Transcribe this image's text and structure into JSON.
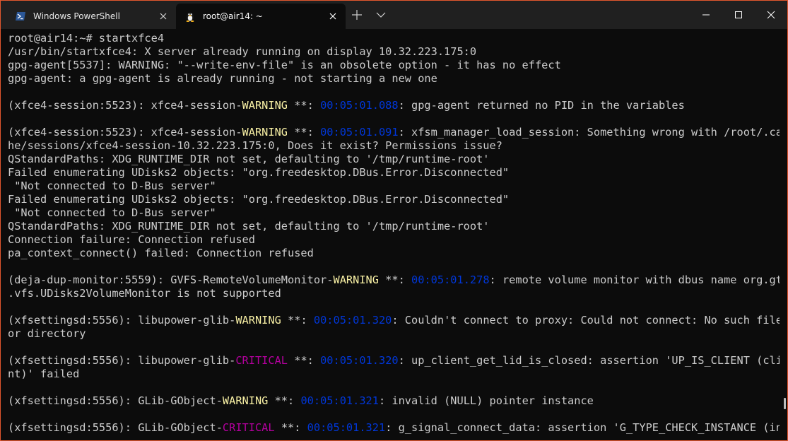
{
  "window": {
    "accent_color": "#e3572e",
    "background_color": "#0c0c0c"
  },
  "tabs": [
    {
      "title": "Windows PowerShell",
      "icon": "powershell-icon",
      "active": false
    },
    {
      "title": "root@air14: ~",
      "icon": "linux-tux-icon",
      "active": true
    }
  ],
  "colors": {
    "normal": "#cccccc",
    "warning": "#f9f1a5",
    "critical": "#b4009e",
    "timestamp": "#0037da"
  },
  "terminal": {
    "lines": [
      [
        {
          "t": "root@air14:~# startxfce4",
          "c": "normal"
        }
      ],
      [
        {
          "t": "/usr/bin/startxfce4: X server already running on display 10.32.223.175:0",
          "c": "normal"
        }
      ],
      [
        {
          "t": "gpg-agent[5537]: WARNING: \"--write-env-file\" is an obsolete option - it has no effect",
          "c": "normal"
        }
      ],
      [
        {
          "t": "gpg-agent: a gpg-agent is already running - not starting a new one",
          "c": "normal"
        }
      ],
      [],
      [
        {
          "t": "(xfce4-session:5523): xfce4-session-",
          "c": "normal"
        },
        {
          "t": "WARNING",
          "c": "warning"
        },
        {
          "t": " **: ",
          "c": "normal"
        },
        {
          "t": "00:05:01.088",
          "c": "timestamp"
        },
        {
          "t": ": gpg-agent returned no PID in the variables",
          "c": "normal"
        }
      ],
      [],
      [
        {
          "t": "(xfce4-session:5523): xfce4-session-",
          "c": "normal"
        },
        {
          "t": "WARNING",
          "c": "warning"
        },
        {
          "t": " **: ",
          "c": "normal"
        },
        {
          "t": "00:05:01.091",
          "c": "timestamp"
        },
        {
          "t": ": xfsm_manager_load_session: Something wrong with /root/.cac",
          "c": "normal"
        }
      ],
      [
        {
          "t": "he/sessions/xfce4-session-10.32.223.175:0, Does it exist? Permissions issue?",
          "c": "normal"
        }
      ],
      [
        {
          "t": "QStandardPaths: XDG_RUNTIME_DIR not set, defaulting to '/tmp/runtime-root'",
          "c": "normal"
        }
      ],
      [
        {
          "t": "Failed enumerating UDisks2 objects: \"org.freedesktop.DBus.Error.Disconnected\"",
          "c": "normal"
        }
      ],
      [
        {
          "t": " \"Not connected to D-Bus server\"",
          "c": "normal"
        }
      ],
      [
        {
          "t": "Failed enumerating UDisks2 objects: \"org.freedesktop.DBus.Error.Disconnected\"",
          "c": "normal"
        }
      ],
      [
        {
          "t": " \"Not connected to D-Bus server\"",
          "c": "normal"
        }
      ],
      [
        {
          "t": "QStandardPaths: XDG_RUNTIME_DIR not set, defaulting to '/tmp/runtime-root'",
          "c": "normal"
        }
      ],
      [
        {
          "t": "Connection failure: Connection refused",
          "c": "normal"
        }
      ],
      [
        {
          "t": "pa_context_connect() failed: Connection refused",
          "c": "normal"
        }
      ],
      [],
      [
        {
          "t": "(deja-dup-monitor:5559): GVFS-RemoteVolumeMonitor-",
          "c": "normal"
        },
        {
          "t": "WARNING",
          "c": "warning"
        },
        {
          "t": " **: ",
          "c": "normal"
        },
        {
          "t": "00:05:01.278",
          "c": "timestamp"
        },
        {
          "t": ": remote volume monitor with dbus name org.gtk",
          "c": "normal"
        }
      ],
      [
        {
          "t": ".vfs.UDisks2VolumeMonitor is not supported",
          "c": "normal"
        }
      ],
      [],
      [
        {
          "t": "(xfsettingsd:5556): libupower-glib-",
          "c": "normal"
        },
        {
          "t": "WARNING",
          "c": "warning"
        },
        {
          "t": " **: ",
          "c": "normal"
        },
        {
          "t": "00:05:01.320",
          "c": "timestamp"
        },
        {
          "t": ": Couldn't connect to proxy: Could not connect: No such file",
          "c": "normal"
        }
      ],
      [
        {
          "t": "or directory",
          "c": "normal"
        }
      ],
      [],
      [
        {
          "t": "(xfsettingsd:5556): libupower-glib-",
          "c": "normal"
        },
        {
          "t": "CRITICAL",
          "c": "critical"
        },
        {
          "t": " **: ",
          "c": "normal"
        },
        {
          "t": "00:05:01.320",
          "c": "timestamp"
        },
        {
          "t": ": up_client_get_lid_is_closed: assertion 'UP_IS_CLIENT (clie",
          "c": "normal"
        }
      ],
      [
        {
          "t": "nt)' failed",
          "c": "normal"
        }
      ],
      [],
      [
        {
          "t": "(xfsettingsd:5556): GLib-GObject-",
          "c": "normal"
        },
        {
          "t": "WARNING",
          "c": "warning"
        },
        {
          "t": " **: ",
          "c": "normal"
        },
        {
          "t": "00:05:01.321",
          "c": "timestamp"
        },
        {
          "t": ": invalid (NULL) pointer instance",
          "c": "normal"
        }
      ],
      [],
      [
        {
          "t": "(xfsettingsd:5556): GLib-GObject-",
          "c": "normal"
        },
        {
          "t": "CRITICAL",
          "c": "critical"
        },
        {
          "t": " **: ",
          "c": "normal"
        },
        {
          "t": "00:05:01.321",
          "c": "timestamp"
        },
        {
          "t": ": g_signal_connect_data: assertion 'G_TYPE_CHECK_INSTANCE (ins",
          "c": "normal"
        }
      ]
    ]
  }
}
